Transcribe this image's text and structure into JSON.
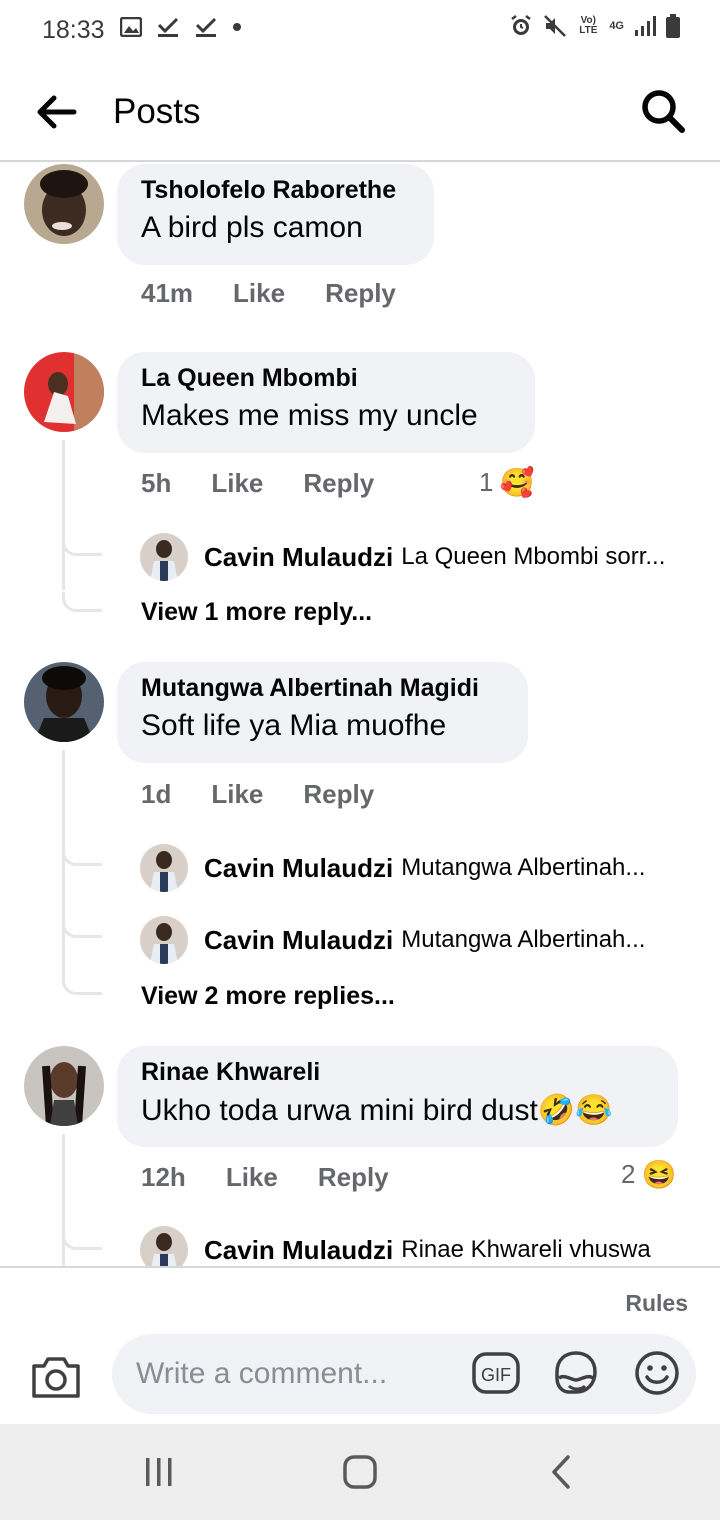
{
  "status_bar": {
    "time": "18:33",
    "left_icons": [
      "image-icon",
      "check-icon",
      "check-icon",
      "dot-icon"
    ],
    "right_icons": [
      "alarm-icon",
      "mute-icon",
      "volte-icon",
      "4g-icon",
      "signal-icon",
      "battery-icon"
    ],
    "volte_label": "Vo) LTE",
    "network_label": "4G"
  },
  "header": {
    "title": "Posts",
    "back_icon": "back-arrow-icon",
    "search_icon": "search-icon"
  },
  "comments": [
    {
      "author": "Tsholofelo Raborethe",
      "text": "A bird pls camon",
      "time": "41m",
      "like_label": "Like",
      "reply_label": "Reply",
      "avatar_color": "#6b4e3d"
    },
    {
      "author": "La Queen Mbombi",
      "text": "Makes me miss my uncle",
      "time": "5h",
      "like_label": "Like",
      "reply_label": "Reply",
      "reaction_count": "1",
      "reaction_emoji": "🥰",
      "avatar_color": "#d62828",
      "replies": [
        {
          "author": "Cavin Mulaudzi",
          "text": "La Queen Mbombi sorr..."
        }
      ],
      "view_more": "View 1 more reply..."
    },
    {
      "author": "Mutangwa Albertinah Magidi",
      "text": "Soft life ya Mia muofhe",
      "time": "1d",
      "like_label": "Like",
      "reply_label": "Reply",
      "avatar_color": "#2d2d2d",
      "replies": [
        {
          "author": "Cavin Mulaudzi",
          "text": "Mutangwa Albertinah..."
        },
        {
          "author": "Cavin Mulaudzi",
          "text": "Mutangwa Albertinah..."
        }
      ],
      "view_more": "View 2 more replies..."
    },
    {
      "author": "Rinae Khwareli",
      "text": "Ukho toda urwa mini bird dust🤣😂",
      "time": "12h",
      "like_label": "Like",
      "reply_label": "Reply",
      "reaction_count": "2",
      "reaction_emoji": "😆",
      "avatar_color": "#5a5a5a",
      "replies": [
        {
          "author": "Cavin Mulaudzi",
          "text": "Rinae Khwareli vhuswa"
        }
      ]
    }
  ],
  "composer": {
    "rules_label": "Rules",
    "placeholder": "Write a comment...",
    "camera_icon": "camera-icon",
    "gif_label": "GIF",
    "sticker_icon": "sticker-icon",
    "emoji_icon": "smiley-icon"
  },
  "nav_bar": {
    "icons": [
      "recent-apps-icon",
      "home-icon",
      "back-icon"
    ]
  },
  "colors": {
    "bubble_bg": "#f0f2f5",
    "meta_text": "#65676b",
    "thread_line": "#e4e6eb"
  }
}
